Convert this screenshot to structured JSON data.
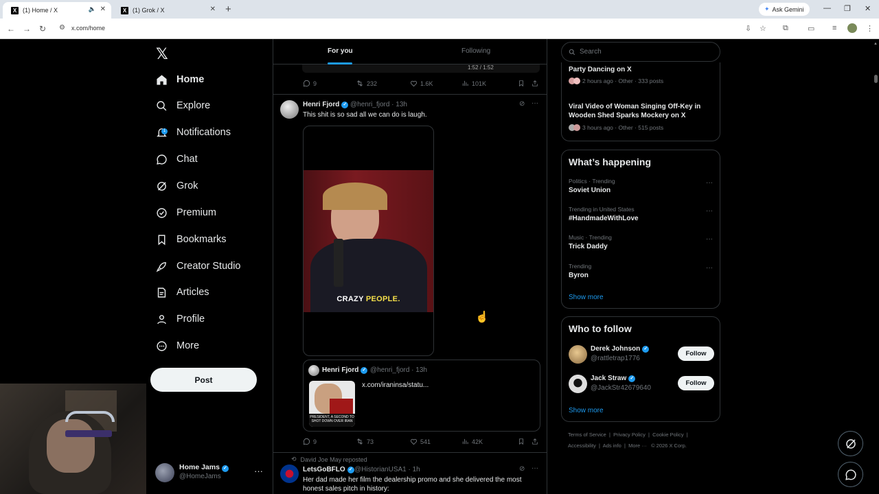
{
  "browser": {
    "tabs": [
      {
        "title": "(1) Home / X",
        "active": true
      },
      {
        "title": "(1) Grok / X",
        "active": false
      }
    ],
    "ask_gemini": "Ask Gemini",
    "url": "x.com/home"
  },
  "sidebar": {
    "logo": "𝕏",
    "items": [
      {
        "label": "Home",
        "icon": "home-icon"
      },
      {
        "label": "Explore",
        "icon": "search-icon"
      },
      {
        "label": "Notifications",
        "icon": "bell-icon",
        "badge": "1"
      },
      {
        "label": "Chat",
        "icon": "chat-icon"
      },
      {
        "label": "Grok",
        "icon": "grok-icon"
      },
      {
        "label": "Premium",
        "icon": "premium-icon"
      },
      {
        "label": "Bookmarks",
        "icon": "bookmark-icon"
      },
      {
        "label": "Creator Studio",
        "icon": "rocket-icon"
      },
      {
        "label": "Articles",
        "icon": "articles-icon"
      },
      {
        "label": "Profile",
        "icon": "person-icon"
      },
      {
        "label": "More",
        "icon": "more-circle-icon"
      }
    ],
    "post_label": "Post",
    "account": {
      "name": "Home Jams",
      "handle": "@HomeJams"
    }
  },
  "feed": {
    "tabs": [
      "For you",
      "Following"
    ],
    "prev_tweet_actions": {
      "replies": "9",
      "reposts": "232",
      "likes": "1.6K",
      "views": "101K"
    },
    "tweet": {
      "name": "Henri Fjord",
      "handle": "@henri_fjord",
      "time": "13h",
      "text": "This shit is so sad all we can do is laugh.",
      "caption_white": "CRAZY",
      "caption_yellow": "PEOPLE.",
      "quote": {
        "name": "Henri Fjord",
        "handle": "@henri_fjord",
        "time": "13h",
        "link": "x.com/iraninsa/statu...",
        "thumb_caption": "PRESIDENT, A SECOND TO SHOT DOWN OVER IRAN"
      },
      "actions": {
        "replies": "9",
        "reposts": "73",
        "likes": "541",
        "views": "42K"
      }
    },
    "next_tweet": {
      "repost_by": "David Joe May reposted",
      "name": "LetsGoBFLO",
      "handle": "@HistorianUSA1",
      "time": "1h",
      "text": "Her dad made her film the dealership promo and she delivered the most honest sales pitch in history:"
    }
  },
  "right": {
    "search_placeholder": "Search",
    "news": [
      {
        "title": "Party Dancing on X",
        "meta": "2 hours ago · Other · 333 posts"
      },
      {
        "title": "Viral Video of Woman Singing Off-Key in Wooden Shed Sparks Mockery on X",
        "meta": "3 hours ago · Other · 515 posts"
      }
    ],
    "whats_happening": {
      "heading": "What’s happening",
      "trends": [
        {
          "category": "Politics · Trending",
          "name": "Soviet Union"
        },
        {
          "category": "Trending in United States",
          "name": "#HandmadeWithLove"
        },
        {
          "category": "Music · Trending",
          "name": "Trick Daddy"
        },
        {
          "category": "Trending",
          "name": "Byron"
        }
      ],
      "show_more": "Show more"
    },
    "who_to_follow": {
      "heading": "Who to follow",
      "accounts": [
        {
          "name": "Derek Johnson",
          "handle": "@rattletrap1776",
          "button": "Follow"
        },
        {
          "name": "Jack Straw",
          "handle": "@JackStr42679640",
          "button": "Follow"
        }
      ],
      "show_more": "Show more"
    },
    "footer": {
      "line1": [
        "Terms of Service",
        "Privacy Policy",
        "Cookie Policy"
      ],
      "line2": [
        "Accessibility",
        "Ads info",
        "More ···",
        "© 2026 X Corp."
      ]
    }
  }
}
